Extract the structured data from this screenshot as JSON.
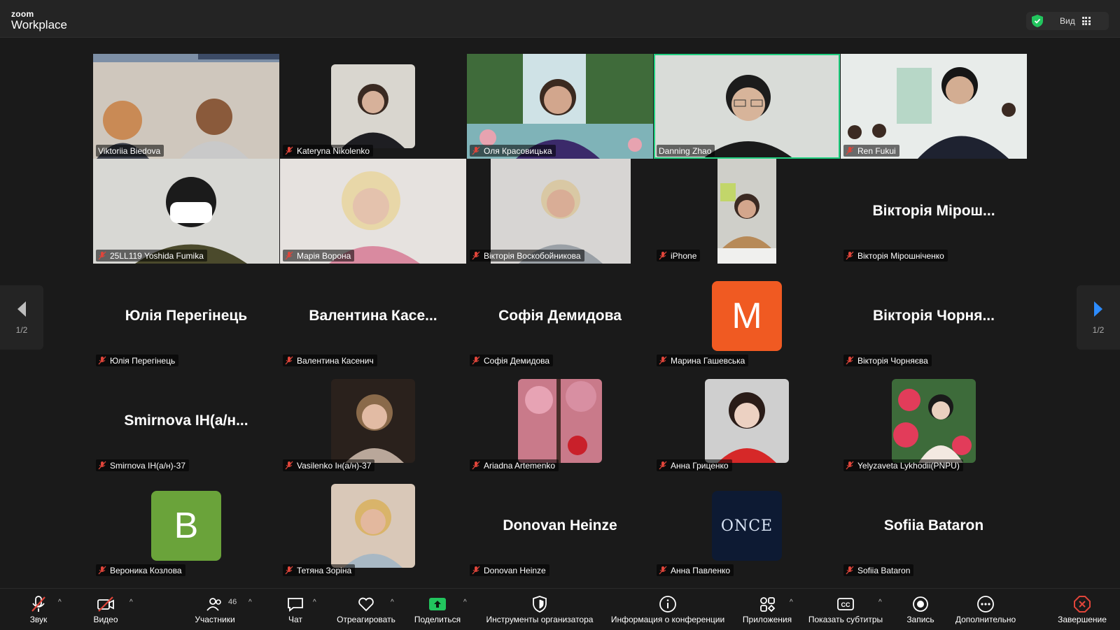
{
  "app": {
    "brand_small": "zoom",
    "brand_big": "Workplace",
    "view_label": "Вид"
  },
  "pager": {
    "left": "1/2",
    "right": "1/2"
  },
  "colors": {
    "active_border": "#22d081",
    "share_green": "#22c55e",
    "mute_red": "#e0453a",
    "end_red": "#e0453a"
  },
  "tiles": [
    {
      "label": "Viktoriia Biedova",
      "center": ""
    },
    {
      "label": "Kateryna Nikolenko",
      "center": ""
    },
    {
      "label": "Оля Красовицька",
      "center": ""
    },
    {
      "label": "Danning Zhao",
      "center": ""
    },
    {
      "label": "Ren Fukui",
      "center": ""
    },
    {
      "label": "25LL119 Yoshida Fumika",
      "center": ""
    },
    {
      "label": "Марія Ворона",
      "center": ""
    },
    {
      "label": "Вікторія Воскобойникова",
      "center": ""
    },
    {
      "label": "iPhone",
      "center": ""
    },
    {
      "label": "Вікторія Мірошніченко",
      "center": "Вікторія Мірош..."
    },
    {
      "label": "Юлія Перегінець",
      "center": "Юлія Перегінець"
    },
    {
      "label": "Валентина Касенич",
      "center": "Валентина  Касе..."
    },
    {
      "label": "Софія Демидова",
      "center": "Софія Демидова"
    },
    {
      "label": "Марина Гашевська",
      "center": "",
      "avatar_letter": "M"
    },
    {
      "label": "Вікторія Чорняєва",
      "center": "Вікторія Чорня..."
    },
    {
      "label": "Smirnova ІН(а/н)-37",
      "center": "Smirnova ІН(а/н..."
    },
    {
      "label": "Vasilenko Ін(а/н)-37",
      "center": ""
    },
    {
      "label": "Ariadna Artemenko",
      "center": ""
    },
    {
      "label": "Анна Гриценко",
      "center": ""
    },
    {
      "label": "Yelyzaveta Lykhodii(PNPU)",
      "center": ""
    },
    {
      "label": "Вероника Козлова",
      "center": "",
      "avatar_letter": "B"
    },
    {
      "label": "Тетяна Зоріна",
      "center": ""
    },
    {
      "label": "Donovan Heinze",
      "center": "Donovan Heinze"
    },
    {
      "label": "Анна Павленко",
      "center": "",
      "photo_text": "ONCE"
    },
    {
      "label": "Sofiia Bataron",
      "center": "Sofiia Bataron"
    }
  ],
  "toolbar": {
    "audio": "Звук",
    "video": "Видео",
    "participants": "Участники",
    "participants_count": "46",
    "chat": "Чат",
    "react": "Отреагировать",
    "share": "Поделиться",
    "host_tools": "Инструменты организатора",
    "meeting_info": "Информация о конференции",
    "apps": "Приложения",
    "captions": "Показать субтитры",
    "record": "Запись",
    "more": "Дополнительно",
    "end": "Завершение"
  }
}
